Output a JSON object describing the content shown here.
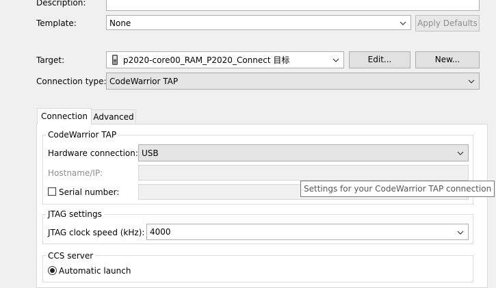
{
  "form": {
    "description_label": "Description:",
    "template_label": "Template:",
    "template_value": "None",
    "apply_defaults_label": "Apply Defaults",
    "target_label": "Target:",
    "target_value": "p2020-core00_RAM_P2020_Connect 目标",
    "edit_label": "Edit...",
    "new_label": "New...",
    "connection_type_label": "Connection type:",
    "connection_type_value": "CodeWarrior TAP"
  },
  "tabs": [
    {
      "label": "Connection",
      "active": true
    },
    {
      "label": "Advanced",
      "active": false
    }
  ],
  "groups": {
    "tap_title": "CodeWarrior TAP",
    "hardware_connection_label": "Hardware connection:",
    "hardware_connection_value": "USB",
    "hostname_label": "Hostname/IP:",
    "serial_number_label": "Serial number:",
    "serial_checked": false,
    "jtag_title": "JTAG settings",
    "jtag_clock_label": "JTAG clock speed (kHz):",
    "jtag_clock_value": "4000",
    "ccs_title": "CCS server",
    "automatic_launch_label": "Automatic launch"
  },
  "tooltip": "Settings for your CodeWarrior TAP connection",
  "icons": {
    "target": "target-device-icon",
    "dropdown": "chevron-down-icon"
  }
}
